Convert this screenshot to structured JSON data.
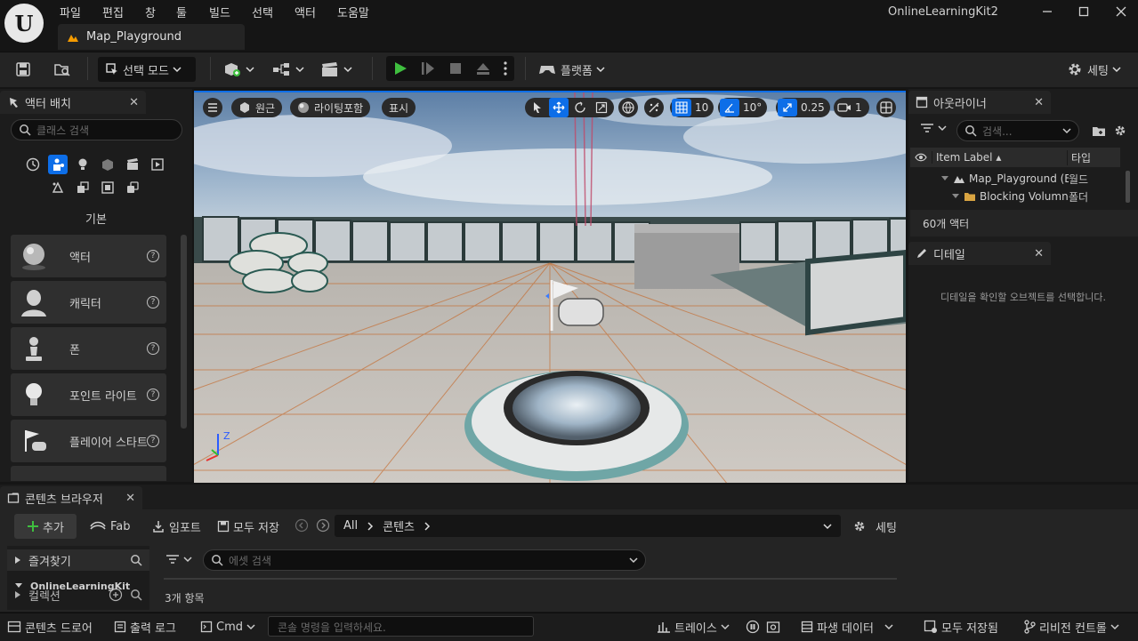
{
  "app": {
    "project": "OnlineLearningKit2",
    "map_tab": "Map_Playground",
    "logo": "U"
  },
  "menu": [
    "파일",
    "편집",
    "창",
    "툴",
    "빌드",
    "선택",
    "액터",
    "도움말"
  ],
  "toolbar": {
    "mode": "선택 모드",
    "platform": "플랫폼",
    "settings": "세팅"
  },
  "place_actors": {
    "title": "액터 배치",
    "search_placeholder": "클래스 검색",
    "category": "기본",
    "items": [
      {
        "label": "액터",
        "icon": "sphere-icon"
      },
      {
        "label": "캐릭터",
        "icon": "character-icon"
      },
      {
        "label": "폰",
        "icon": "pawn-icon"
      },
      {
        "label": "포인트 라이트",
        "icon": "light-bulb-icon"
      },
      {
        "label": "플레이어 스타트",
        "icon": "player-start-icon"
      }
    ]
  },
  "viewport": {
    "perspective": "원근",
    "lighting": "라이팅포함",
    "show": "표시",
    "grid_snap": "10",
    "rot_snap": "10°",
    "scale_snap": "0.25",
    "camera_speed": "1",
    "axis_z": "Z"
  },
  "outliner": {
    "title": "아웃라이너",
    "search_placeholder": "검색...",
    "col_label": "Item Label",
    "col_type": "타입",
    "rows": [
      {
        "label": "Map_Playground (Ed",
        "type": "월드"
      },
      {
        "label": "Blocking Volumn",
        "type": "폴더"
      }
    ],
    "count": "60개 액터"
  },
  "details": {
    "title": "디테일",
    "empty": "디테일을 확인할 오브젝트를 선택합니다."
  },
  "content_browser": {
    "title": "콘텐츠 브라우저",
    "add": "추가",
    "fab": "Fab",
    "import": "임포트",
    "save_all": "모두 저장",
    "path": [
      "All",
      "콘텐츠"
    ],
    "settings": "세팅",
    "favorites": "즐겨찾기",
    "project_folder": "OnlineLearningKit",
    "collections": "컬렉션",
    "search_placeholder": "에셋 검색",
    "item_count": "3개 항목"
  },
  "statusbar": {
    "drawer": "콘텐츠 드로어",
    "output_log": "출력 로그",
    "cmd": "Cmd",
    "console_placeholder": "콘솔 명령을 입력하세요.",
    "trace": "트레이스",
    "derived_data": "파생 데이터",
    "save_all": "모두 저장됨",
    "revision": "리비전 컨트롤"
  },
  "colors": {
    "accent": "#0d6ee8",
    "play": "#3fbf3f",
    "selected_orange": "#f59b00"
  }
}
